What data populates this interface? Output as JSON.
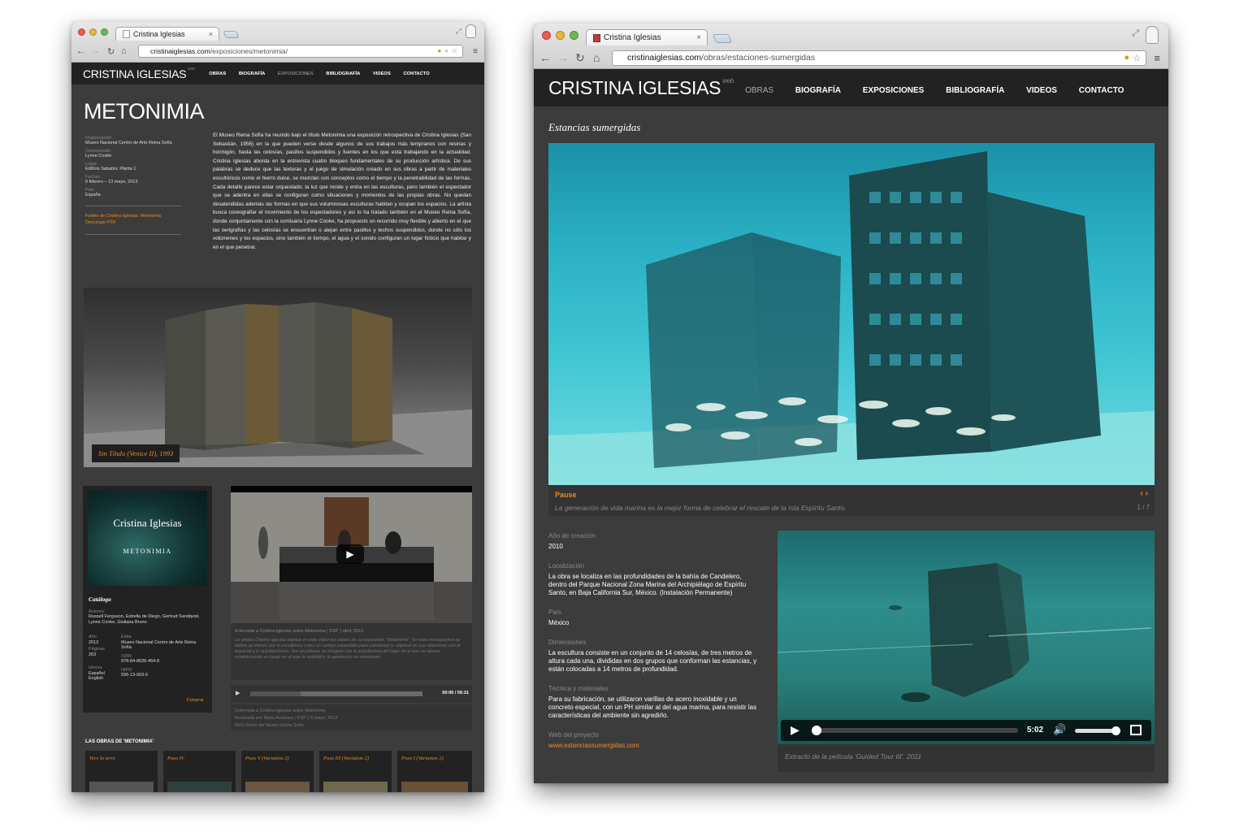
{
  "left_window": {
    "tab_title": "Cristina Iglesias",
    "url_domain": "cristinaiglesias.com",
    "url_path": "/exposiciones/metonimia/",
    "site": {
      "logo": "CRISTINA IGLESIAS",
      "logo_sup": "web",
      "nav": [
        "OBRAS",
        "BIOGRAFÍA",
        "EXPOSICIONES",
        "BIBLIOGRAFÍA",
        "VIDEOS",
        "CONTACTO"
      ],
      "nav_active_index": 2
    },
    "page_title": "METONIMIA",
    "meta": [
      {
        "label": "Organización",
        "value": "Museo Nacional Centro de Arte Reina Sofía"
      },
      {
        "label": "Comisariado",
        "value": "Lynne Cooke"
      },
      {
        "label": "Lugar",
        "value": "Edificio Sabatini, Planta 1"
      },
      {
        "label": "Fechas",
        "value": "6 febrero – 13 mayo, 2013"
      },
      {
        "label": "País",
        "value": "España"
      }
    ],
    "pdf_link_1": "Folleto de Cristina Iglesias. Metonimia",
    "pdf_link_2": "Descargar PDF",
    "body_text": "El Museo Reina Sofía ha reunido bajo el título Metonimia una exposición retrospectiva de Cristina Iglesias (San Sebastián, 1956) en la que pueden verse desde algunos de sus trabajos más tempranos con resinas y hormigón, hasta las celosías, pasillos suspendidos y fuentes en los que está trabajando en la actualidad. Cristina Iglesias aborda en la entrevista cuatro bloques fundamentales de su producción artística. De sus palabras se deduce que las texturas y el juego de simulación creado en sus obras a partir de materiales escultóricos como el hierro dulce, se mezclan con conceptos como el tiempo y la penetrabilidad de las formas. Cada detalle parece estar orquestado; la luz que incide y entra en las esculturas, pero también el espectador que se adentra en ellas se configuran como situaciones y momentos de las propias obras. No quedan desatendidas además las formas en que sus voluminosas esculturas habitan y ocupan los espacios. La artista busca coreografiar el movimiento de los espectadores y así lo ha tratado también en el Museo Reina Sofía, donde conjuntamente con la comisaria Lynne Cooke, ha propuesto un recorrido muy flexible y abierto en el que las serigrafías y las celosías se encuentran o alejan entre pasillos y techos suspendidos, donde no sólo los volúmenes y los espacios, sino también el tiempo, el agua y el sonido configuran un lugar ficticio que habitar y en el que penetrar.",
    "image_caption": "Sin Título (Venice II), 1993",
    "catalog": {
      "cover_name": "Cristina Iglesias",
      "cover_title": "METONIMIA",
      "heading": "Catálogo",
      "authors_label": "Autores",
      "authors": "Russell Ferguson, Estrella de Diego, Gertrud Sandqvist, Lynne Cooke, Giuliana Bruno",
      "year_label": "Año",
      "year": "2013",
      "edit_label": "Edita",
      "edit": "Museo Nacional Centro de Arte Reina Sofía",
      "pages_label": "Páginas",
      "pages": "263",
      "isbn_label": "ISBN",
      "isbn": "978-84-8026-464-8",
      "lang_label": "Idioma",
      "lang": "Español English",
      "nipo_label": "NIPO",
      "nipo": "036-13-003-6",
      "buy": "Comprar"
    },
    "video_caption_title": "Entrevista a Cristina Iglesias sobre Metonimia | 3'30\" | abril, 2013",
    "video_caption_body": "La artista Cristina Iglesias explica en este vídeo las claves de su exposición \"Metonimia\". En esta retrospectiva se define su interés por lo escultórico como un campo expandido para cuestionar lo objetual en sus relaciones con lo espacial y lo arquitectónico. Sus esculturas se integran con la arquitectura del lugar en el que se ubican, estableciendo un juego en el que la realidad y la apariencia se entrelazan.",
    "audio_time": "00:00 / 06:31",
    "audio_line1": "Entrevista a Cristina Iglesias sobre Metonimia",
    "audio_line2": "Realizada por Maita Andueza | 6'20\" | 6 mayo, 2013",
    "audio_line3": "RRS Radio del Museo Reina Sofía",
    "works_title": "LAS OBRAS DE 'METONIMIA'",
    "works": [
      "Vers la terre",
      "Pozo IV",
      "Pozo V (Variation 2)",
      "Pozo III (Variation 2)",
      "Pozo I (Variation 2)"
    ]
  },
  "right_window": {
    "tab_title": "Cristina Iglesias",
    "url_domain": "cristinaiglesias.com",
    "url_path": "/obras/estaciones-sumergidas",
    "site": {
      "logo": "CRISTINA IGLESIAS",
      "logo_sup": "web",
      "nav": [
        "OBRAS",
        "BIOGRAFÍA",
        "EXPOSICIONES",
        "BIBLIOGRAFÍA",
        "VIDEOS",
        "CONTACTO"
      ],
      "nav_active_index": 0
    },
    "subtitle": "Estancias sumergidas",
    "slide_pause": "Pause",
    "slide_arrows": "‹ ›",
    "slide_caption": "La generación de vida marina es la mejor forma de celebrar el rescate de la Isla Espíritu Santo.",
    "slide_count": "1 / 7",
    "details": [
      {
        "label": "Año de creación",
        "value": "2010"
      },
      {
        "label": "Localización",
        "value": "La obra se localiza en las profundidades de la bahía de Candelero, dentro del Parque Nacional Zona Marina del Archipiélago de Espíritu Santo, en Baja California Sur, México. (Instalación Permanente)"
      },
      {
        "label": "País",
        "value": "México"
      },
      {
        "label": "Dimensiones",
        "value": "La escultura consiste en un conjunto de 14 celosías, de tres metros de altura cada una, divididas en dos grupos que conforman las estancias, y están colocadas a 14 metros de profundidad."
      },
      {
        "label": "Técnica y materiales",
        "value": "Para su fabricación, se utilizaron varillas de acero inoxidable y un concreto especial, con un PH similar al del agua marina, para resistir las características del ambiente sin agredirlo."
      }
    ],
    "web_label": "Web del proyecto",
    "web_link": "www.estanciassumergidas.com",
    "video_time": "5:02",
    "video_caption": "Extracto de la película 'Guided Tour III'. 2011"
  }
}
